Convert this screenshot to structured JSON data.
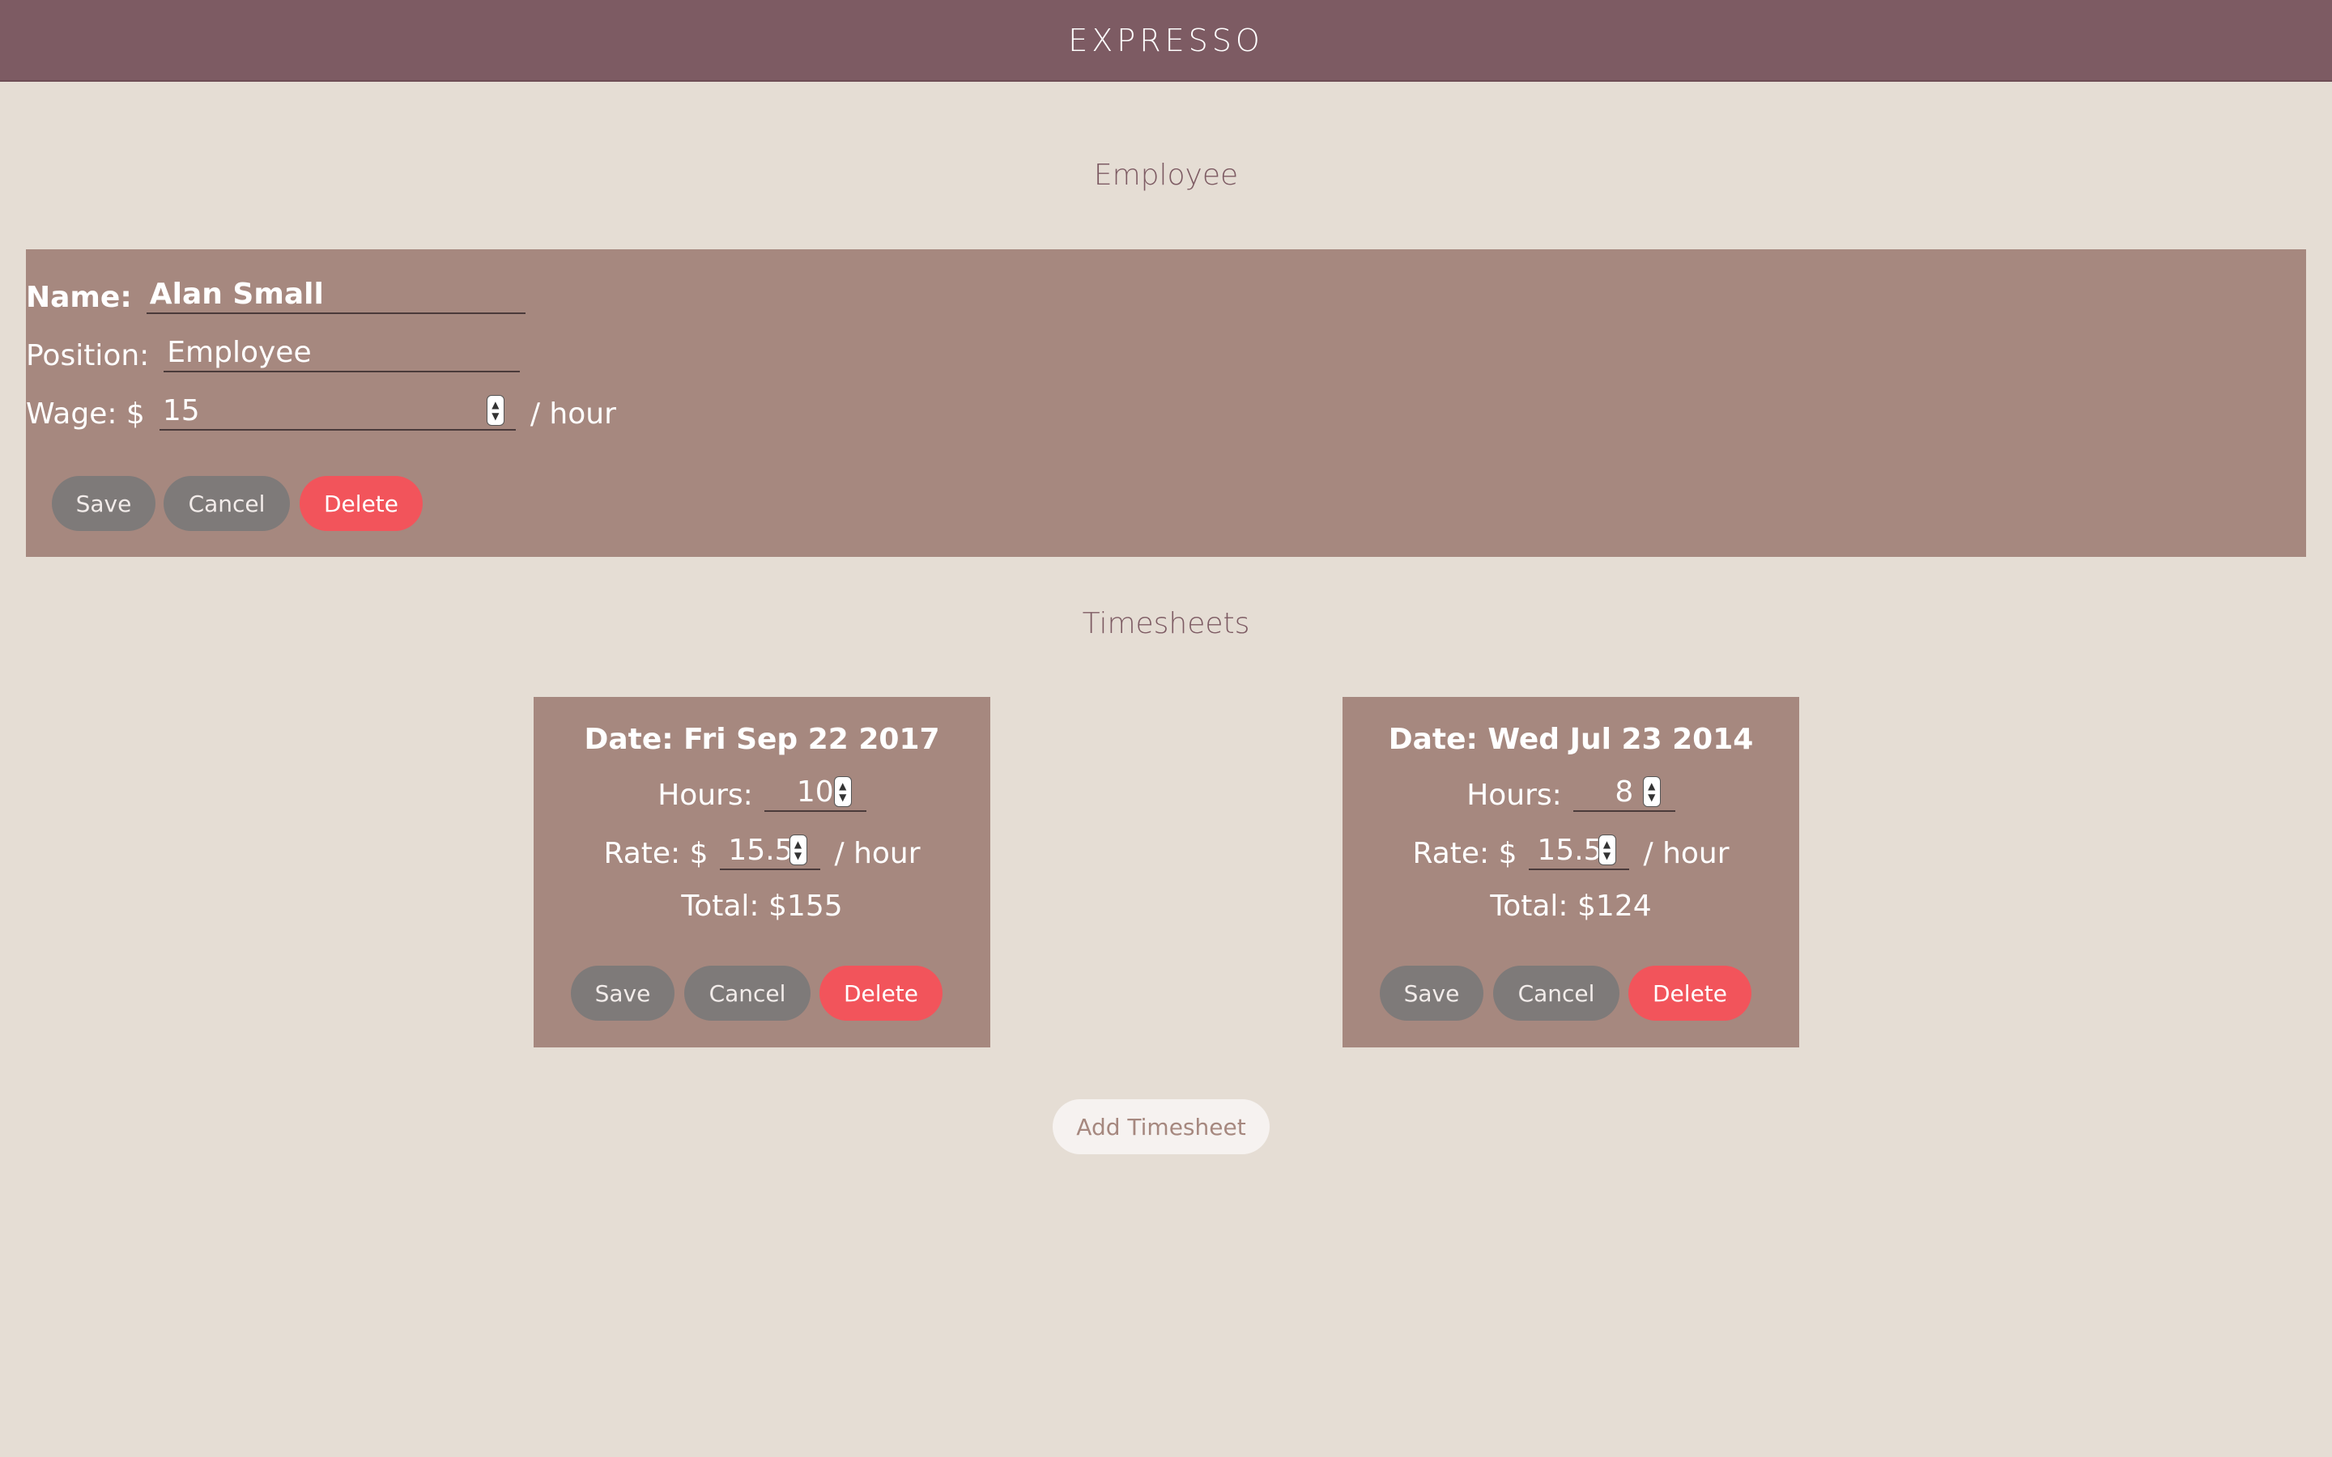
{
  "header": {
    "brand": "EXPRESSO"
  },
  "employee": {
    "section_title": "Employee",
    "name_label": "Name:",
    "name_value": "Alan Small",
    "position_label": "Position:",
    "position_value": "Employee",
    "wage_label": "Wage: $",
    "wage_value": "15",
    "wage_unit": "/ hour",
    "buttons": {
      "save": "Save",
      "cancel": "Cancel",
      "delete": "Delete"
    }
  },
  "timesheets": {
    "section_title": "Timesheets",
    "items": [
      {
        "date": "Date: Fri Sep 22 2017",
        "hours_label": "Hours:",
        "hours_value": "10",
        "rate_label": "Rate: $",
        "rate_value": "15.5",
        "rate_unit": "/ hour",
        "total": "Total: $155",
        "buttons": {
          "save": "Save",
          "cancel": "Cancel",
          "delete": "Delete"
        }
      },
      {
        "date": "Date: Wed Jul 23 2014",
        "hours_label": "Hours:",
        "hours_value": "8",
        "rate_label": "Rate: $",
        "rate_value": "15.5",
        "rate_unit": "/ hour",
        "total": "Total: $124",
        "buttons": {
          "save": "Save",
          "cancel": "Cancel",
          "delete": "Delete"
        }
      }
    ],
    "add_button": "Add Timesheet"
  },
  "colors": {
    "header_bg": "#7d5b63",
    "page_bg": "#e5ddd4",
    "card_bg": "#a6887f",
    "button_grey": "#7e7a79",
    "button_danger": "#f2545b"
  }
}
